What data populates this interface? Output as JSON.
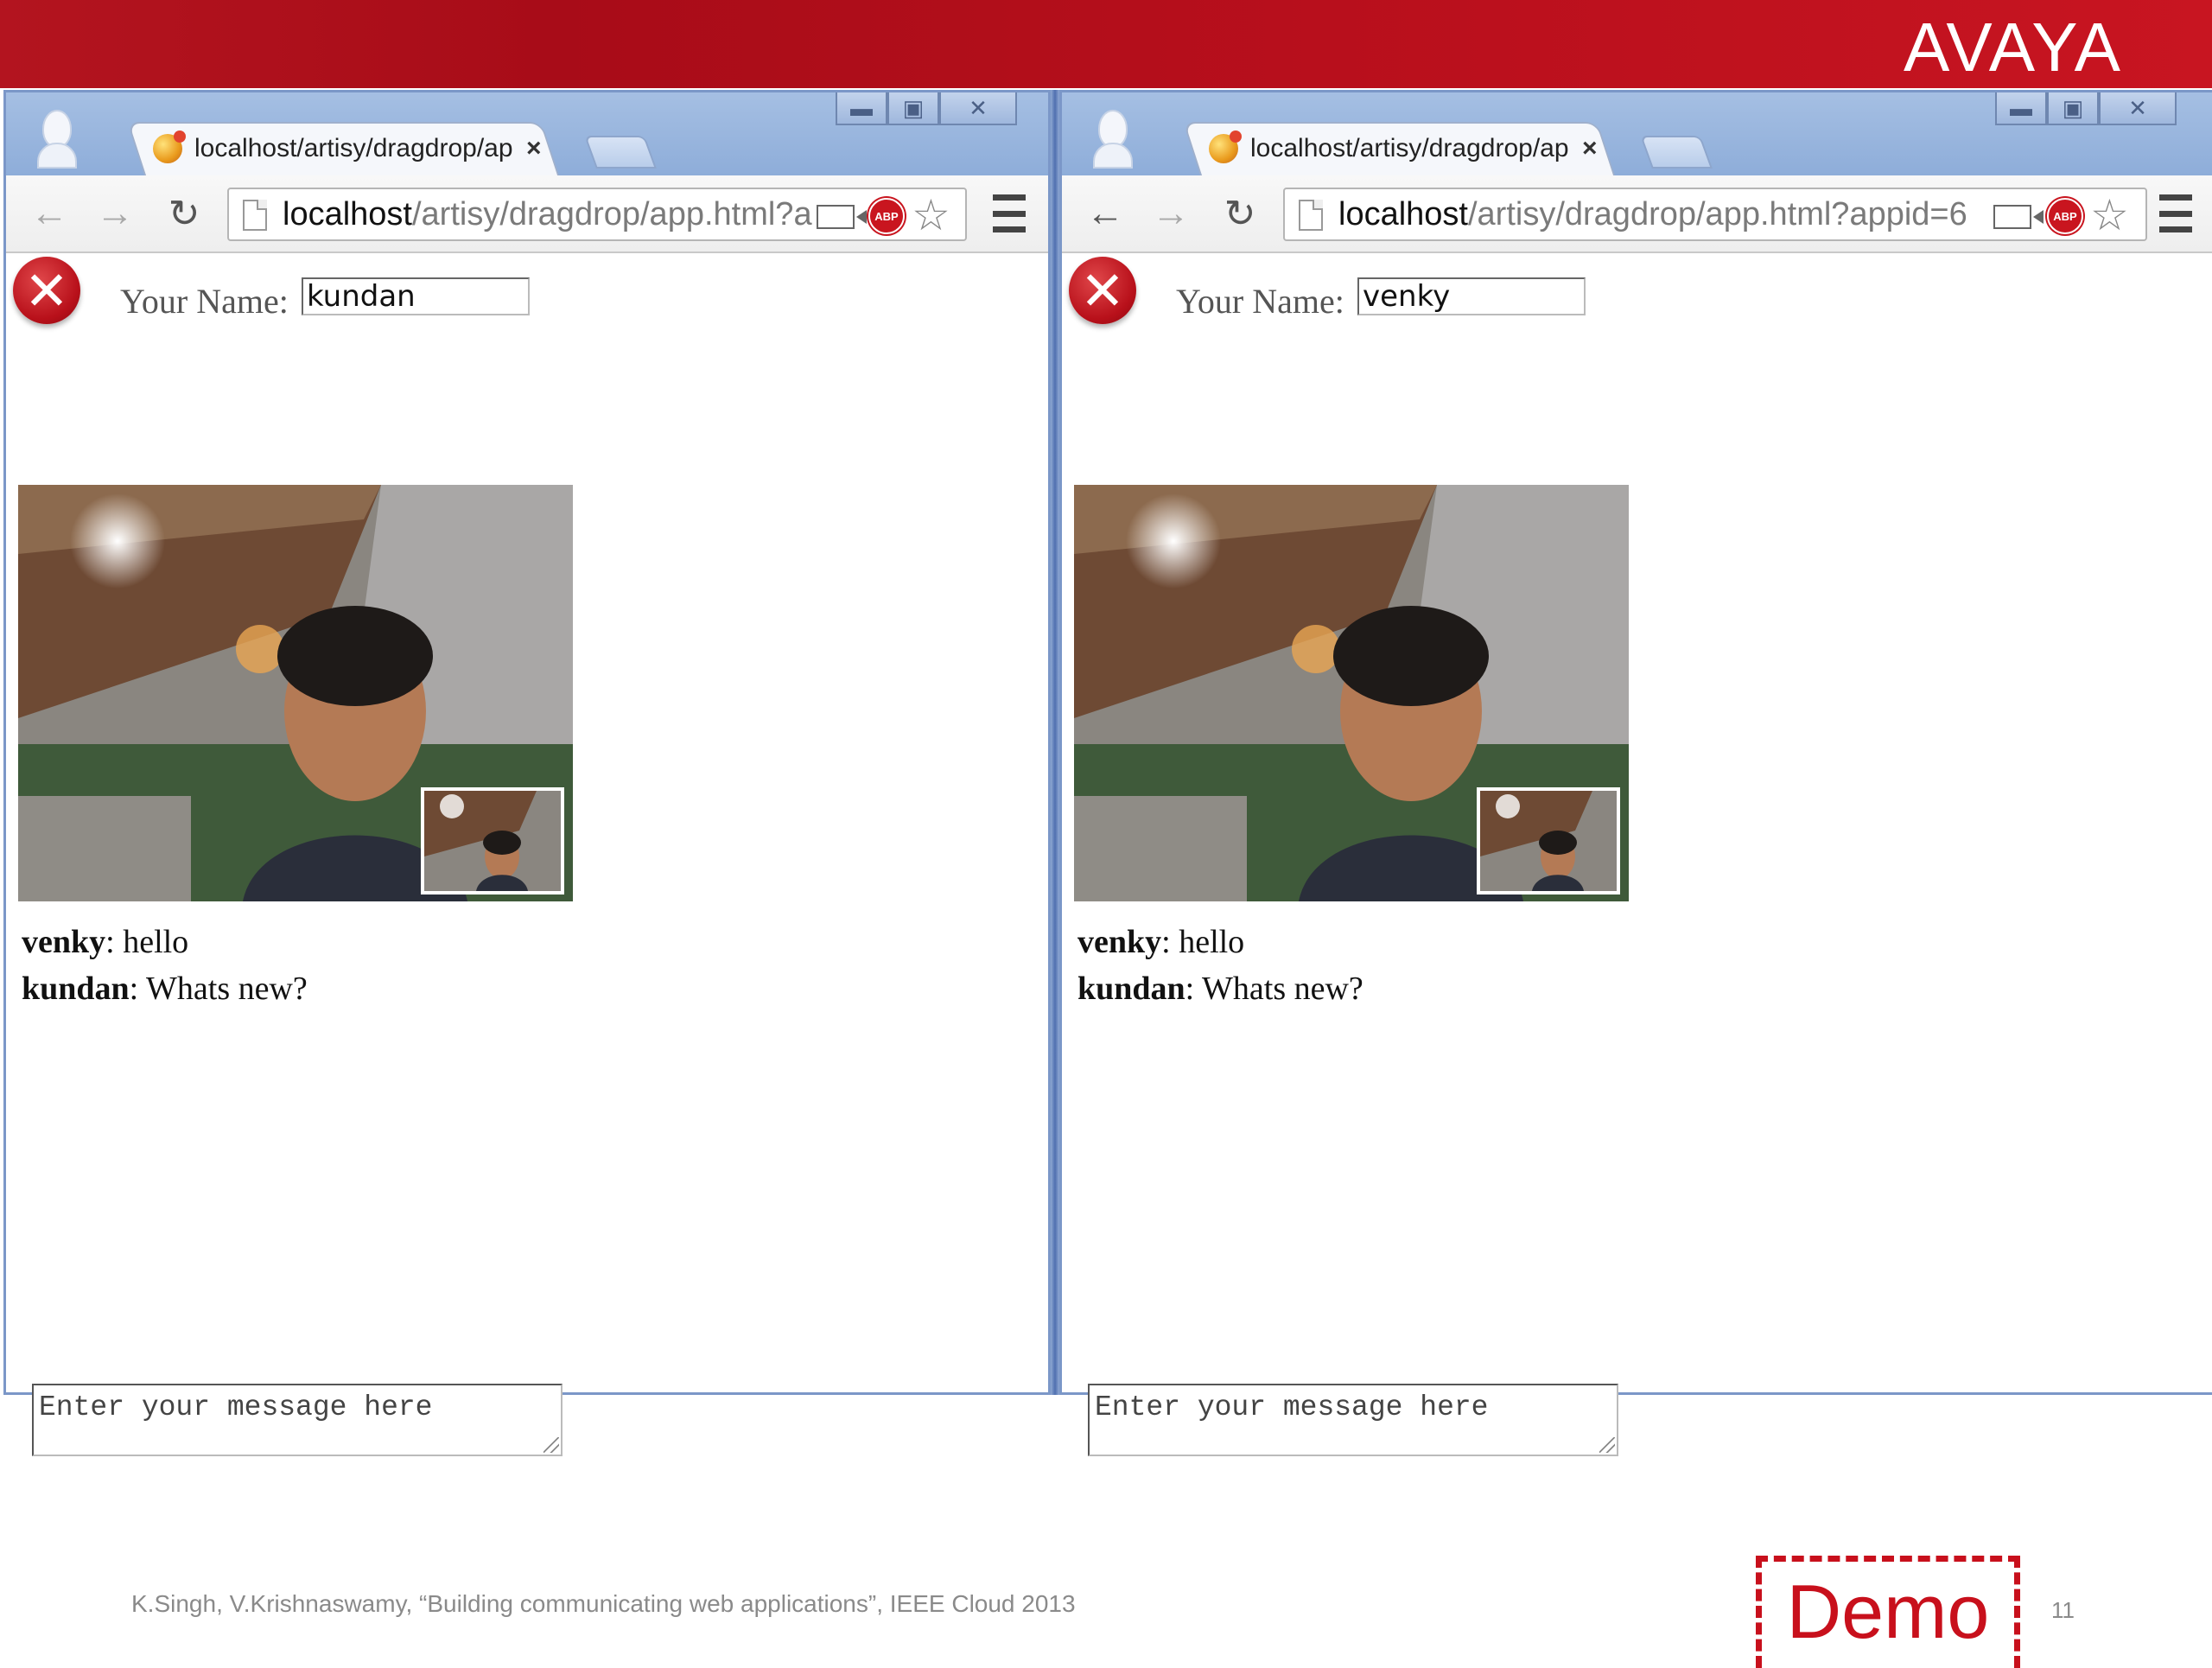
{
  "slide": {
    "brand": "AVAYA",
    "citation": "K.Singh, V.Krishnaswamy, “Building communicating web applications”, IEEE Cloud 2013",
    "demo_label": "Demo",
    "page_number": "11",
    "brand_color": "#c8101c"
  },
  "windows": [
    {
      "tab_title": "localhost/artisy/dragdrop/ap",
      "tab_close": "×",
      "url_host": "localhost",
      "url_path": "/artisy/dragdrop/app.html?a",
      "abp_label": "ABP",
      "name_label": "Your Name:",
      "name_value": "kundan",
      "chat": [
        {
          "user": "venky",
          "message": ": hello"
        },
        {
          "user": "kundan",
          "message": ": Whats new?"
        }
      ],
      "message_placeholder": "Enter your message here"
    },
    {
      "tab_title": "localhost/artisy/dragdrop/ap",
      "tab_close": "×",
      "url_host": "localhost",
      "url_path": "/artisy/dragdrop/app.html?appid=6",
      "abp_label": "ABP",
      "name_label": "Your Name:",
      "name_value": "venky",
      "chat": [
        {
          "user": "venky",
          "message": ": hello"
        },
        {
          "user": "kundan",
          "message": ": Whats new?"
        }
      ],
      "message_placeholder": "Enter your message here"
    }
  ]
}
